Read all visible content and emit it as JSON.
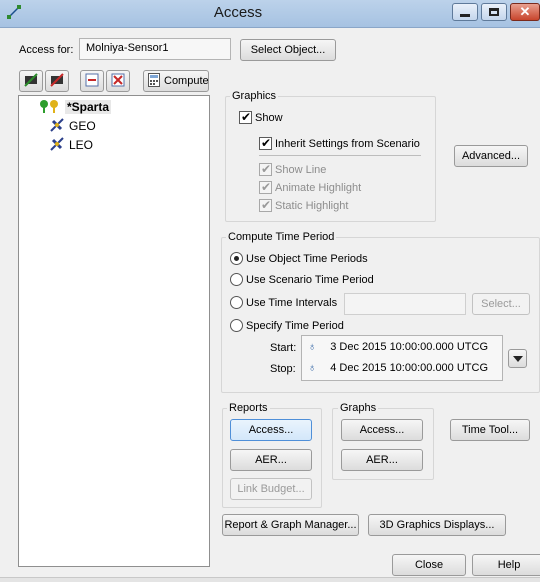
{
  "window": {
    "title": "Access"
  },
  "access_for": {
    "label": "Access for:",
    "value": "Molniya-Sensor1",
    "select_button": "Select Object..."
  },
  "toolbar": {
    "compute_label": "Compute"
  },
  "tree": {
    "items": [
      {
        "label": "*Sparta",
        "icon": "facility-icon",
        "bold": true
      },
      {
        "label": "GEO",
        "icon": "satellite-icon"
      },
      {
        "label": "LEO",
        "icon": "satellite-icon"
      }
    ]
  },
  "graphics": {
    "title": "Graphics",
    "show": "Show",
    "inherit": "Inherit Settings from Scenario",
    "show_line": "Show Line",
    "animate": "Animate Highlight",
    "static": "Static Highlight",
    "advanced": "Advanced..."
  },
  "compute_period": {
    "title": "Compute Time Period",
    "use_object": "Use Object Time Periods",
    "use_scenario": "Use Scenario Time Period",
    "use_intervals": "Use Time Intervals",
    "intervals_select": "Select...",
    "specify": "Specify Time Period",
    "start_label": "Start:",
    "start_value": "3 Dec 2015 10:00:00.000 UTCG",
    "stop_label": "Stop:",
    "stop_value": "4 Dec 2015 10:00:00.000 UTCG"
  },
  "reports": {
    "title": "Reports",
    "access": "Access...",
    "aer": "AER...",
    "link_budget": "Link Budget..."
  },
  "graphs": {
    "title": "Graphs",
    "access": "Access...",
    "aer": "AER..."
  },
  "time_tool": "Time Tool...",
  "report_graph_manager": "Report & Graph Manager...",
  "graphics_3d": "3D Graphics Displays...",
  "close": "Close",
  "help": "Help"
}
